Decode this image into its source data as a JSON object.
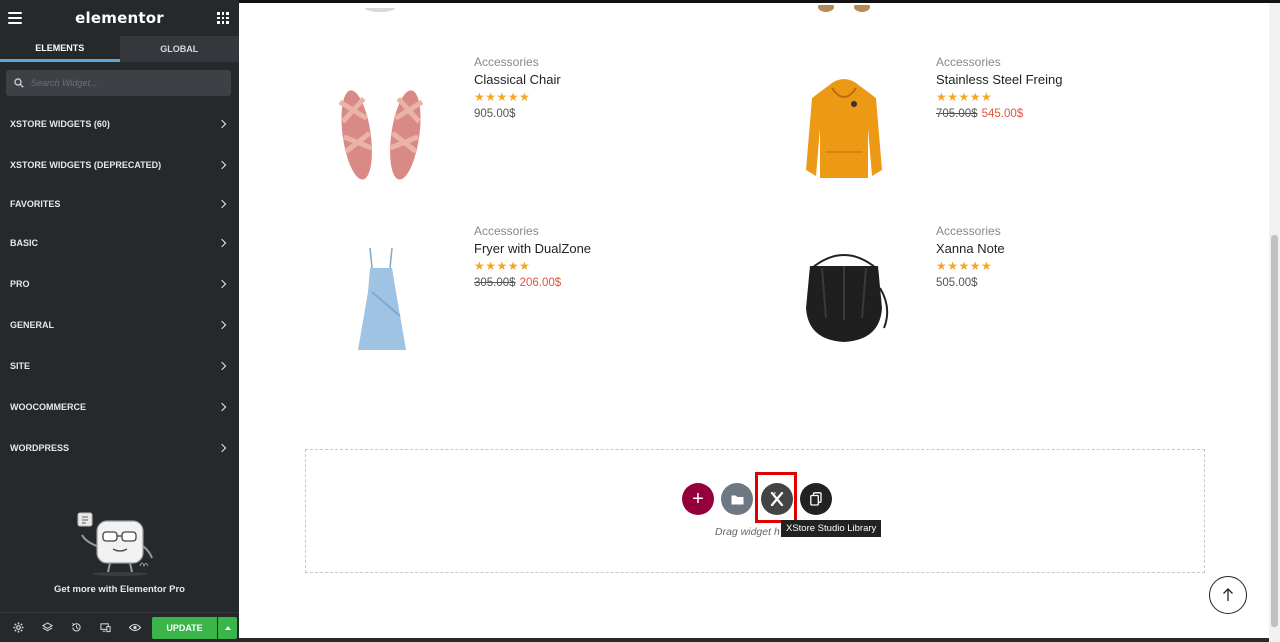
{
  "sidebar": {
    "logo": "elementor",
    "tabs": [
      {
        "label": "ELEMENTS"
      },
      {
        "label": "GLOBAL"
      }
    ],
    "search": {
      "placeholder": "Search Widget..."
    },
    "categories": [
      {
        "label": "XSTORE WIDGETS (60)"
      },
      {
        "label": "XSTORE WIDGETS (DEPRECATED)"
      },
      {
        "label": "FAVORITES"
      },
      {
        "label": "BASIC"
      },
      {
        "label": "PRO"
      },
      {
        "label": "GENERAL"
      },
      {
        "label": "SITE"
      },
      {
        "label": "WOOCOMMERCE"
      },
      {
        "label": "WORDPRESS"
      }
    ],
    "promo_text": "Get more with Elementor Pro",
    "footer": {
      "update_label": "UPDATE",
      "icons": [
        "settings-icon",
        "layers-icon",
        "history-icon",
        "responsive-icon",
        "preview-icon"
      ]
    }
  },
  "products": [
    {
      "category": "Accessories",
      "title": "Classical Chair",
      "rating": 5,
      "price": "905.00$",
      "old_price": "",
      "sale_price": ""
    },
    {
      "category": "Accessories",
      "title": "Stainless Steel Freing",
      "rating": 5,
      "price": "",
      "old_price": "705.00$",
      "sale_price": "545.00$"
    },
    {
      "category": "Accessories",
      "title": "Fryer with DualZone",
      "rating": 5,
      "price": "",
      "old_price": "305.00$",
      "sale_price": "206.00$"
    },
    {
      "category": "Accessories",
      "title": "Xanna Note",
      "rating": 5,
      "price": "505.00$",
      "old_price": "",
      "sale_price": ""
    }
  ],
  "dropzone": {
    "drag_text": "Drag widget h",
    "tooltip": "XStore Studio Library",
    "buttons": [
      "add-section",
      "add-template",
      "xstore-studio-library",
      "paste"
    ]
  },
  "colors": {
    "sidebar_bg": "#26292c",
    "accent_blue": "#5aa8d6",
    "update_green": "#39b54a",
    "add_button": "#93003c",
    "star": "#f5a623",
    "sale_price": "#e0543c",
    "highlight_red": "#e00000"
  }
}
